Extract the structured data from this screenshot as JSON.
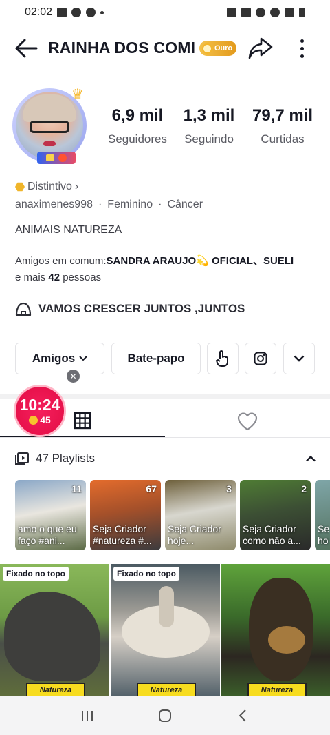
{
  "status_bar": {
    "time": "02:02"
  },
  "header": {
    "title": "RAINHA DOS COMI",
    "badge_label": "Ouro"
  },
  "stats": [
    {
      "value": "6,9 mil",
      "label": "Seguidores"
    },
    {
      "value": "1,3 mil",
      "label": "Seguindo"
    },
    {
      "value": "79,7 mil",
      "label": "Curtidas"
    }
  ],
  "profile": {
    "badge_link": "Distintivo",
    "username": "anaximenes998",
    "gender": "Feminino",
    "sign": "Câncer",
    "separator": "·",
    "bio": "ANIMAIS NATUREZA",
    "friends_prefix": "Amigos em comum:",
    "friends_names": "SANDRA ARAUJO💫 OFICIAL、SUELI",
    "friends_more_prefix": "e mais",
    "friends_more_count": "42",
    "friends_more_suffix": "pessoas",
    "community": "VAMOS CRESCER JUNTOS ,JUNTOS"
  },
  "actions": {
    "friends_label": "Amigos",
    "chat_label": "Bate-papo",
    "close": "✕"
  },
  "timer": {
    "time": "10:24",
    "coins": "45"
  },
  "playlists": {
    "header": "47 Playlists",
    "items": [
      {
        "count": "11",
        "caption": "amo o que eu faço #ani..."
      },
      {
        "count": "67",
        "caption": "Seja Criador #natureza #..."
      },
      {
        "count": "3",
        "caption": "Seja Criador hoje..."
      },
      {
        "count": "2",
        "caption": "Seja Criador como não a..."
      },
      {
        "count": "",
        "caption": "Se ho"
      }
    ]
  },
  "videos": [
    {
      "pinned": "Fixado no topo",
      "tag": "Natureza"
    },
    {
      "pinned": "Fixado no topo",
      "tag": "Natureza"
    },
    {
      "pinned": "",
      "tag": "Natureza"
    }
  ],
  "colors": {
    "accent": "#e8124c",
    "gold": "#f0b52a",
    "text": "#161823"
  }
}
